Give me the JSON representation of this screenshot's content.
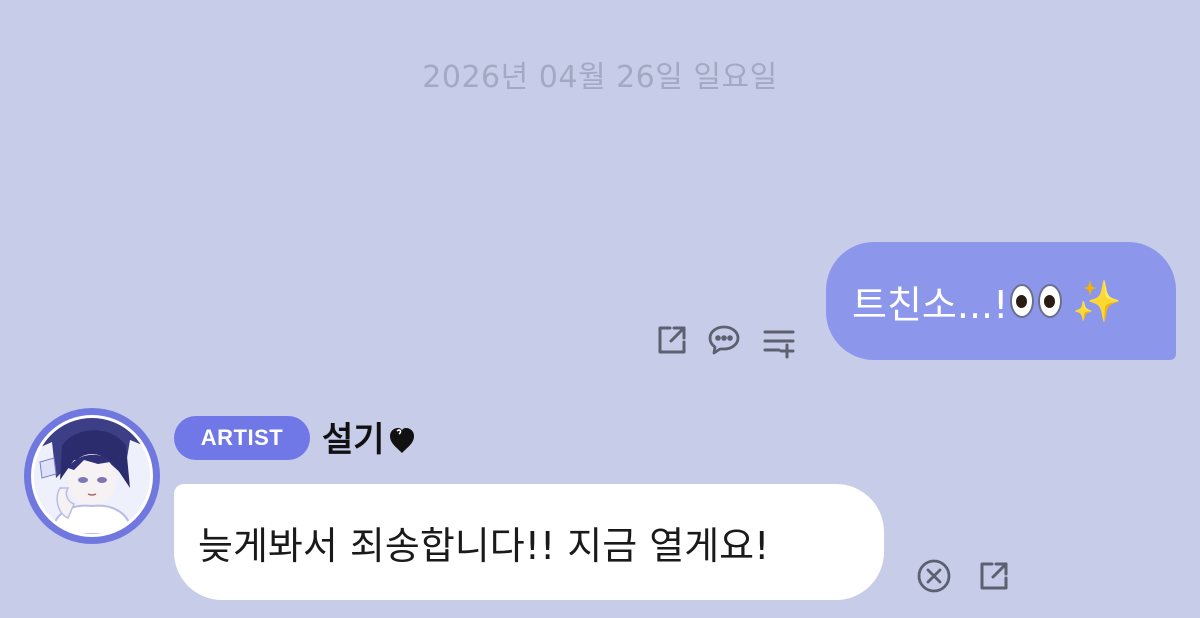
{
  "date_separator": "2026년 04월 26일 일요일",
  "outgoing_message": {
    "text": "트친소...!",
    "emoji_1": "eyes",
    "emoji_2": "sparkles",
    "actions": [
      "share-icon",
      "comment-icon",
      "add-to-list-icon"
    ]
  },
  "incoming_message": {
    "badge": "ARTIST",
    "sender_name": "설기",
    "name_suffix_icon": "heart-icon",
    "text": "늦게봐서 죄송합니다!! 지금 열게요!",
    "actions": [
      "close-icon",
      "share-icon"
    ]
  },
  "colors": {
    "background": "#c7cde9",
    "outgoing_bubble": "#8c97ec",
    "badge": "#6f78e6",
    "date_text": "#a3a9c2"
  }
}
